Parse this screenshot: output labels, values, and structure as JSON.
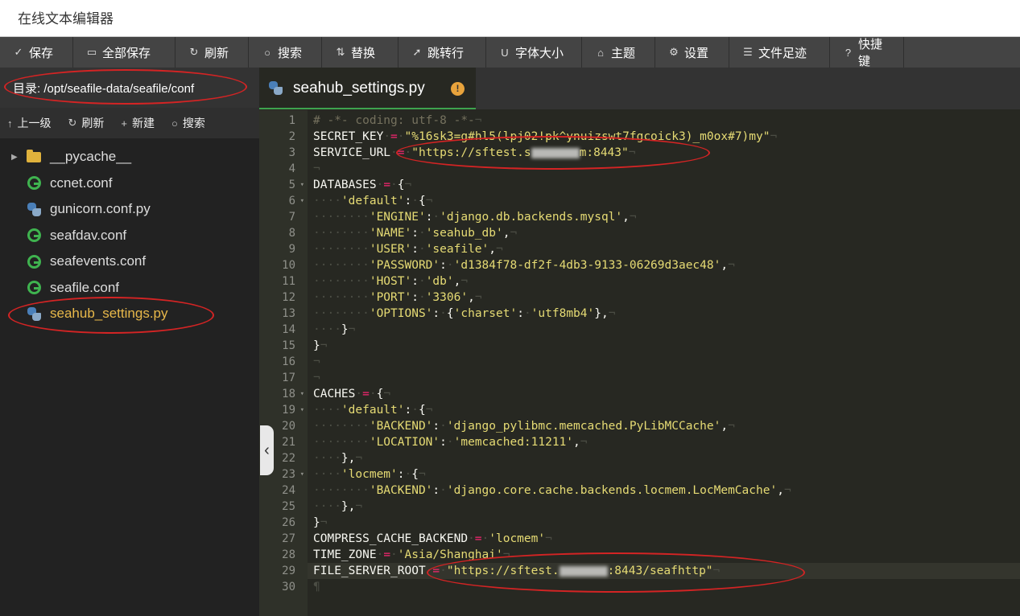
{
  "app": {
    "title": "在线文本编辑器"
  },
  "toolbar": {
    "buttons": [
      {
        "label": "保存",
        "icon": "✓"
      },
      {
        "label": "全部保存",
        "icon": "▭"
      },
      {
        "label": "刷新",
        "icon": "↻"
      },
      {
        "label": "搜索",
        "icon": "○"
      },
      {
        "label": "替换",
        "icon": "⇅"
      },
      {
        "label": "跳转行",
        "icon": "➚"
      },
      {
        "label": "字体大小",
        "icon": "U"
      },
      {
        "label": "主题",
        "icon": "⌂"
      },
      {
        "label": "设置",
        "icon": "⚙"
      },
      {
        "label": "文件足迹",
        "icon": "☰"
      },
      {
        "label": "快捷键",
        "icon": "?"
      }
    ]
  },
  "sidebar": {
    "directory": "目录: /opt/seafile-data/seafile/conf",
    "actions": [
      {
        "label": "上一级",
        "icon": "↑"
      },
      {
        "label": "刷新",
        "icon": "↻"
      },
      {
        "label": "新建",
        "icon": "+"
      },
      {
        "label": "搜索",
        "icon": "○"
      }
    ],
    "files": [
      {
        "name": "__pycache__",
        "type": "folder"
      },
      {
        "name": "ccnet.conf",
        "type": "conf"
      },
      {
        "name": "gunicorn.conf.py",
        "type": "py"
      },
      {
        "name": "seafdav.conf",
        "type": "conf"
      },
      {
        "name": "seafevents.conf",
        "type": "conf"
      },
      {
        "name": "seafile.conf",
        "type": "conf"
      },
      {
        "name": "seahub_settings.py",
        "type": "py",
        "active": true
      }
    ]
  },
  "editor": {
    "tab_name": "seahub_settings.py",
    "warning": "!",
    "current_line": 29,
    "lines": [
      "# -*- coding: utf-8 -*-",
      "SECRET_KEY = \"%16sk3=g#hl5(lpj02!pk^ynuizswt7fgcoick3)_m0ox#7)my\"",
      "SERVICE_URL = \"https://sftest.s[blur]m:8443\"",
      "",
      "DATABASES = {",
      "    'default': {",
      "        'ENGINE': 'django.db.backends.mysql',",
      "        'NAME': 'seahub_db',",
      "        'USER': 'seafile',",
      "        'PASSWORD': 'd1384f78-df2f-4db3-9133-06269d3aec48',",
      "        'HOST': 'db',",
      "        'PORT': '3306',",
      "        'OPTIONS': {'charset': 'utf8mb4'},",
      "    }",
      "}",
      "",
      "",
      "CACHES = {",
      "    'default': {",
      "        'BACKEND': 'django_pylibmc.memcached.PyLibMCCache',",
      "        'LOCATION': 'memcached:11211',",
      "    },",
      "    'locmem': {",
      "        'BACKEND': 'django.core.cache.backends.locmem.LocMemCache',",
      "    },",
      "}",
      "COMPRESS_CACHE_BACKEND = 'locmem'",
      "TIME_ZONE = 'Asia/Shanghai'",
      "FILE_SERVER_ROOT = \"https://sftest.[blur]:8443/seafhttp\"",
      ""
    ],
    "foldable_lines": [
      5,
      6,
      18,
      19,
      23
    ]
  }
}
